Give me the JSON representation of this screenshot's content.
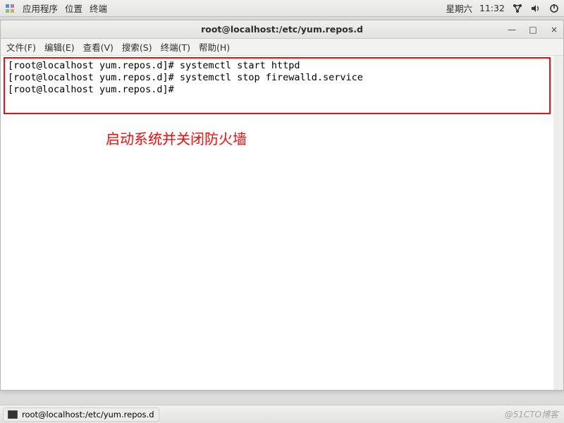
{
  "topbar": {
    "applications": "应用程序",
    "places": "位置",
    "terminal": "终端",
    "clock_day": "星期六",
    "clock_hour": "11:",
    "clock_min": "32"
  },
  "window": {
    "title": "root@localhost:/etc/yum.repos.d"
  },
  "menubar": {
    "file": "文件(F)",
    "edit": "编辑(E)",
    "view": "查看(V)",
    "search": "搜索(S)",
    "terminal": "终端(T)",
    "help": "帮助(H)"
  },
  "winbtn": {
    "minimize": "—",
    "maximize": "□",
    "close": "×"
  },
  "terminal": {
    "lines": [
      "[root@localhost yum.repos.d]# systemctl start httpd",
      "[root@localhost yum.repos.d]# systemctl stop firewalld.service",
      "[root@localhost yum.repos.d]# "
    ]
  },
  "annotation": "启动系统并关闭防火墙",
  "taskbar": {
    "task_label": "root@localhost:/etc/yum.repos.d"
  },
  "watermark": "@51CTO博客"
}
